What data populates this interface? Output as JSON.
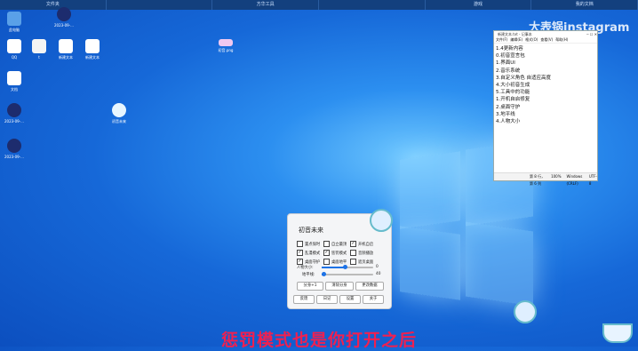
{
  "topbar": {
    "tabs": [
      "文件夹",
      "",
      "方华工具",
      "",
      "游戏",
      "我的文档"
    ]
  },
  "watermark": "大表锅instagram bilibili",
  "desktop_icons": [
    {
      "label": "此电脑"
    },
    {
      "label": "2023-09-..."
    },
    {
      "label": "QQ"
    },
    {
      "label": "t"
    },
    {
      "label": "新建文本"
    },
    {
      "label": "新建文本"
    },
    {
      "label": "初音.png"
    },
    {
      "label": "文档"
    },
    {
      "label": "2023-09-..."
    },
    {
      "label": "2023-09-..."
    },
    {
      "label": "初音未来"
    }
  ],
  "notepad": {
    "title": "新建文本.txt - 记事本",
    "menu": [
      "文件(F)",
      "编辑(E)",
      "格式(O)",
      "查看(V)",
      "帮助(H)"
    ],
    "lines": [
      "1.4更新内容",
      "0.初音宣言包",
      "1.界面UI",
      "2.音乐系统",
      "3.自定义角色 自适应高度",
      "4.大小初音生成",
      "5.工具中的功能",
      " 1.开机自启修复",
      " 2.桌面守护",
      " 3.地平线",
      " 4.人物大小"
    ],
    "status": [
      "第 8 行，第 6 列",
      "100%",
      "Windows (CRLF)",
      "UTF-8"
    ]
  },
  "panel": {
    "title": "初音未来",
    "checks": [
      {
        "label": "置点保时",
        "checked": false
      },
      {
        "label": "自立最顶",
        "checked": false
      },
      {
        "label": "开机自启",
        "checked": true
      },
      {
        "label": "乱漫模式",
        "checked": true
      },
      {
        "label": "惩罚模式",
        "checked": true
      },
      {
        "label": "音频播放",
        "checked": false
      },
      {
        "label": "桌面守护",
        "checked": true
      },
      {
        "label": "桌面地平",
        "checked": false
      },
      {
        "label": "遮页桌面",
        "checked": false
      }
    ],
    "size_label": "人物大小:",
    "size_value": "0",
    "horizon_label": "地平线:",
    "horizon_value": "40",
    "size_level": 0.45,
    "horizon_level": 0.05,
    "buttons_row1": [
      "分身+1",
      "清除分身",
      "更改数据"
    ],
    "buttons_row2": [
      "反馈",
      "日记",
      "设置",
      "关于"
    ]
  },
  "subtitle": "惩罚模式也是你打开之后"
}
